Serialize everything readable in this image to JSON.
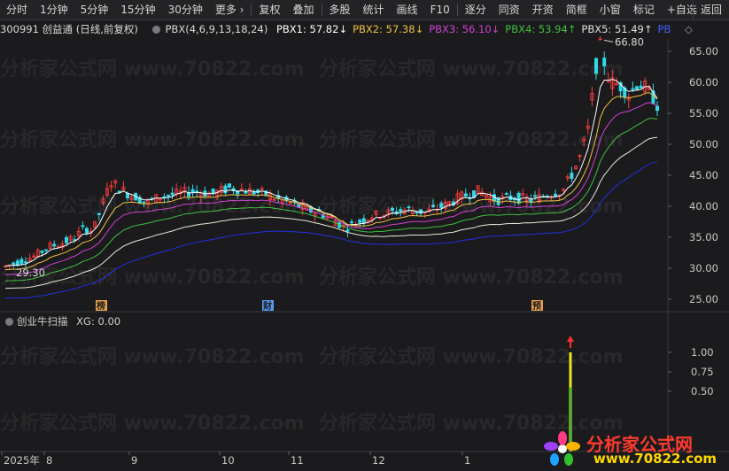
{
  "toolbar": {
    "items": [
      "分时",
      "1分钟",
      "5分钟",
      "15分钟",
      "30分钟",
      "更多 ›",
      "复权",
      "叠加",
      "多股",
      "统计",
      "画线",
      "F10",
      "逐分",
      "同资",
      "开资",
      "简框",
      "小窗",
      "标记",
      "+自选"
    ],
    "back_label": "返回"
  },
  "stock": {
    "code_name": "300991 创益通 (日线,前复权)",
    "indicator": "PBX(4,6,9,13,18,24)",
    "pbx": [
      {
        "label": "PBX1: 57.82↓",
        "color": "#ffffff"
      },
      {
        "label": "PBX2: 57.38↓",
        "color": "#f0c040"
      },
      {
        "label": "PBX3: 56.10↓",
        "color": "#d040d0"
      },
      {
        "label": "PBX4: 53.94↑",
        "color": "#40c040"
      },
      {
        "label": "PBX5: 51.49↑",
        "color": "#e0e0e0"
      },
      {
        "label": "PB",
        "color": "#4060ff"
      }
    ],
    "settings_icon": "diamond-icon"
  },
  "price_axis": {
    "ticks": [
      "65.00",
      "60.00",
      "55.00",
      "50.00",
      "45.00",
      "40.00",
      "35.00",
      "30.00",
      "25.00"
    ]
  },
  "annotations": {
    "high_label": "66.80",
    "low_label": "29.30",
    "event_markers": [
      "榜",
      "财",
      "预"
    ]
  },
  "sub_panel": {
    "title": "创业牛扫描",
    "value_label": "XG: 0.00",
    "ticks": [
      "1.00",
      "0.75",
      "0.50"
    ]
  },
  "time_axis": {
    "labels": [
      "2025年",
      "8",
      "9",
      "10",
      "11",
      "12",
      "1"
    ]
  },
  "watermark_text": "分析家公式网 www.70822.com",
  "logo": {
    "line1": "分析家公式网",
    "line2": "www.70822.com"
  },
  "colors": {
    "up": "#ff3b3b",
    "down": "#30d8e8",
    "background": "#1b1b1d"
  }
}
